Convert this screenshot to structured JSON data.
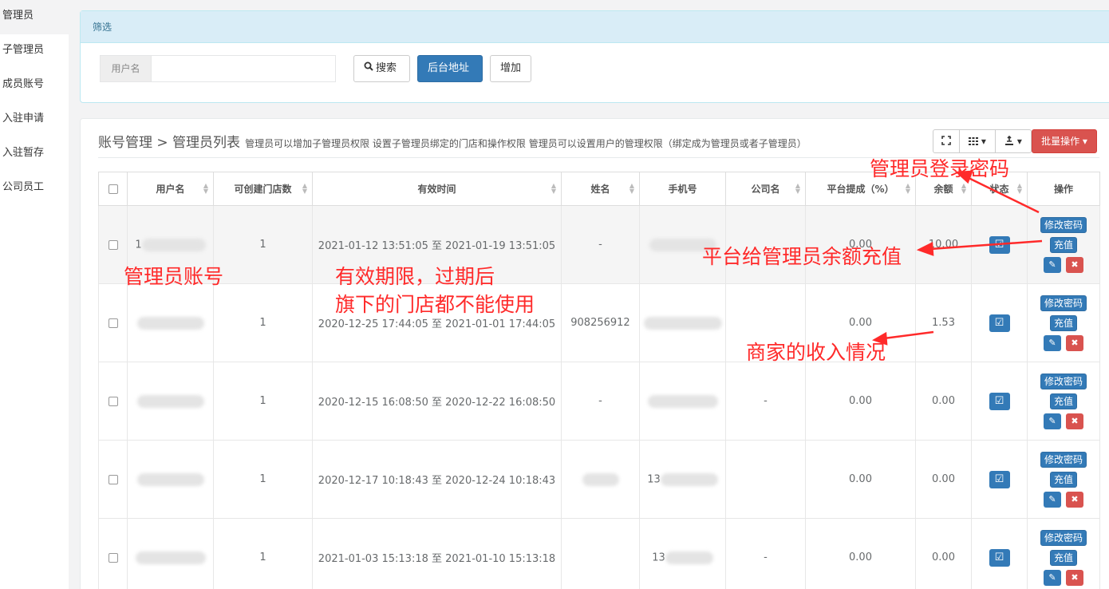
{
  "sidebar": {
    "items": [
      {
        "label": "管理员"
      },
      {
        "label": "子管理员"
      },
      {
        "label": "成员账号"
      },
      {
        "label": "入驻申请"
      },
      {
        "label": "入驻暂存"
      },
      {
        "label": "公司员工"
      }
    ]
  },
  "filter": {
    "title": "筛选",
    "username_label": "用户名",
    "username_value": "",
    "search_label": "搜索",
    "backend_label": "后台地址",
    "add_label": "增加"
  },
  "list": {
    "breadcrumb": "账号管理 > 管理员列表",
    "description": "管理员可以增加子管理员权限 设置子管理员绑定的门店和操作权限 管理员可以设置用户的管理权限（绑定成为管理员或者子管理员）",
    "batch_label": "批量操作",
    "columns": [
      "用户名",
      "可创建门店数",
      "有效时间",
      "姓名",
      "手机号",
      "公司名",
      "平台提成（%）",
      "余额",
      "状态",
      "操作"
    ],
    "rows": [
      {
        "username": "1",
        "stores": "1",
        "valid": "2021-01-12 13:51:05 至 2021-01-19 13:51:05",
        "name": "-",
        "phone": "",
        "company": "",
        "commission": "0.00",
        "balance": "10.00"
      },
      {
        "username": "",
        "stores": "1",
        "valid": "2020-12-25 17:44:05 至 2021-01-01 17:44:05",
        "name": "908256912",
        "phone": "",
        "company": "",
        "commission": "0.00",
        "balance": "1.53"
      },
      {
        "username": "",
        "stores": "1",
        "valid": "2020-12-15 16:08:50 至 2020-12-22 16:08:50",
        "name": "-",
        "phone": "",
        "company": "-",
        "commission": "0.00",
        "balance": "0.00"
      },
      {
        "username": "",
        "stores": "1",
        "valid": "2020-12-17 10:18:43 至 2020-12-24 10:18:43",
        "name": "",
        "phone": "13",
        "company": "",
        "commission": "0.00",
        "balance": "0.00"
      },
      {
        "username": "",
        "stores": "1",
        "valid": "2021-01-03 15:13:18 至 2021-01-10 15:13:18",
        "name": "",
        "phone": "13",
        "company": "-",
        "commission": "0.00",
        "balance": "0.00"
      }
    ],
    "op_labels": {
      "password": "修改密码",
      "recharge": "充值"
    }
  },
  "annotations": {
    "login_password": "管理员登录密码",
    "recharge": "平台给管理员余额充值",
    "account": "管理员账号",
    "validity_1": "有效期限，过期后",
    "validity_2": "旗下的门店都不能使用",
    "income": "商家的收入情况"
  },
  "colors": {
    "primary": "#337ab7",
    "danger": "#d9534f",
    "filter_header": "#d9edf7",
    "annotation": "#ff2a2a"
  }
}
